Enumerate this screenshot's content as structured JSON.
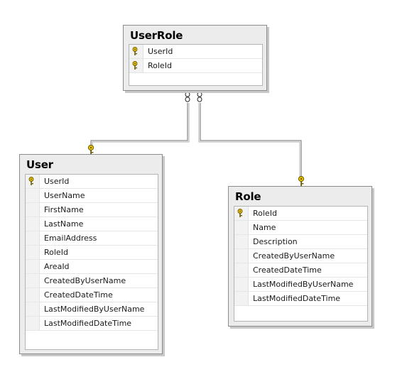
{
  "tables": {
    "userrole": {
      "title": "UserRole",
      "columns": [
        {
          "name": "UserId",
          "key": true
        },
        {
          "name": "RoleId",
          "key": true
        }
      ]
    },
    "user": {
      "title": "User",
      "columns": [
        {
          "name": "UserId",
          "key": true
        },
        {
          "name": "UserName",
          "key": false
        },
        {
          "name": "FirstName",
          "key": false
        },
        {
          "name": "LastName",
          "key": false
        },
        {
          "name": "EmailAddress",
          "key": false
        },
        {
          "name": "RoleId",
          "key": false
        },
        {
          "name": "AreaId",
          "key": false
        },
        {
          "name": "CreatedByUserName",
          "key": false
        },
        {
          "name": "CreatedDateTime",
          "key": false
        },
        {
          "name": "LastModifiedByUserName",
          "key": false
        },
        {
          "name": "LastModifiedDateTime",
          "key": false
        }
      ]
    },
    "role": {
      "title": "Role",
      "columns": [
        {
          "name": "RoleId",
          "key": true
        },
        {
          "name": "Name",
          "key": false
        },
        {
          "name": "Description",
          "key": false
        },
        {
          "name": "CreatedByUserName",
          "key": false
        },
        {
          "name": "CreatedDateTime",
          "key": false
        },
        {
          "name": "LastModifiedByUserName",
          "key": false
        },
        {
          "name": "LastModifiedDateTime",
          "key": false
        }
      ]
    }
  },
  "relationships": [
    {
      "from": "user",
      "to": "userrole",
      "from_end": "key-icon",
      "to_end": "infinity-icon"
    },
    {
      "from": "role",
      "to": "userrole",
      "from_end": "key-icon",
      "to_end": "infinity-icon"
    }
  ],
  "colors": {
    "key_icon": "#e8c400",
    "connector": "#6e6e6e",
    "title_bar": "#ececec"
  }
}
